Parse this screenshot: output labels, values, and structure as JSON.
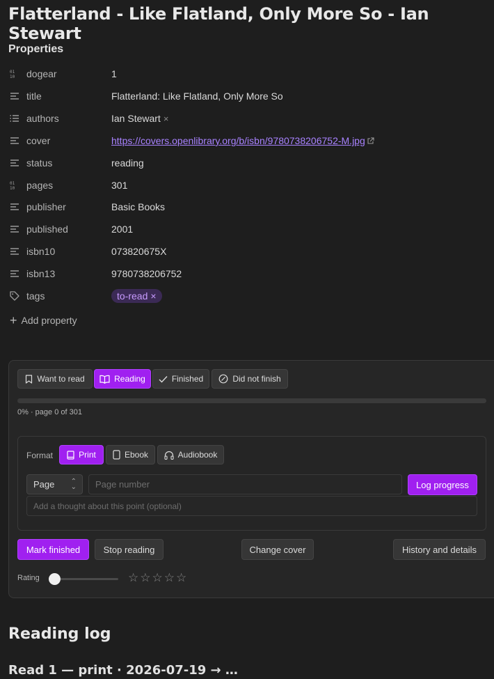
{
  "page_title": "Flatterland - Like Flatland, Only More So - Ian Stewart",
  "properties_heading": "Properties",
  "properties": [
    {
      "icon": "number-icon",
      "key": "dogear",
      "value": "1"
    },
    {
      "icon": "text-icon",
      "key": "title",
      "value": "Flatterland: Like Flatland, Only More So"
    },
    {
      "icon": "list-icon",
      "key": "authors",
      "value": "Ian Stewart"
    },
    {
      "icon": "text-icon",
      "key": "cover",
      "value": "https://covers.openlibrary.org/b/isbn/9780738206752-M.jpg"
    },
    {
      "icon": "text-icon",
      "key": "status",
      "value": "reading"
    },
    {
      "icon": "number-icon",
      "key": "pages",
      "value": "301"
    },
    {
      "icon": "text-icon",
      "key": "publisher",
      "value": "Basic Books"
    },
    {
      "icon": "text-icon",
      "key": "published",
      "value": "2001"
    },
    {
      "icon": "text-icon",
      "key": "isbn10",
      "value": "073820675X"
    },
    {
      "icon": "text-icon",
      "key": "isbn13",
      "value": "9780738206752"
    },
    {
      "icon": "tag-icon",
      "key": "tags",
      "value": "to-read"
    }
  ],
  "chip_remove": "×",
  "add_property": "Add property",
  "status_buttons": {
    "want_to_read": "Want to read",
    "reading": "Reading",
    "finished": "Finished",
    "did_not_finish": "Did not finish"
  },
  "progress": {
    "fraction": 0,
    "text": "0% · page 0 of 301"
  },
  "format": {
    "label": "Format",
    "print": "Print",
    "ebook": "Ebook",
    "audiobook": "Audiobook"
  },
  "log": {
    "unit_selected": "Page",
    "page_placeholder": "Page number",
    "log_button": "Log progress",
    "thought_placeholder": "Add a thought about this point (optional)"
  },
  "actions": {
    "mark_finished": "Mark finished",
    "stop_reading": "Stop reading",
    "change_cover": "Change cover",
    "history": "History and details"
  },
  "rating": {
    "label": "Rating",
    "value": 0,
    "stars": [
      "☆",
      "☆",
      "☆",
      "☆",
      "☆"
    ]
  },
  "reading_log_heading": "Reading log",
  "read_entry": "Read 1 — print · 2026-07-19 → …",
  "colors": {
    "accent": "#a020f0",
    "background": "#1e1e1e",
    "link": "#a882ff"
  }
}
